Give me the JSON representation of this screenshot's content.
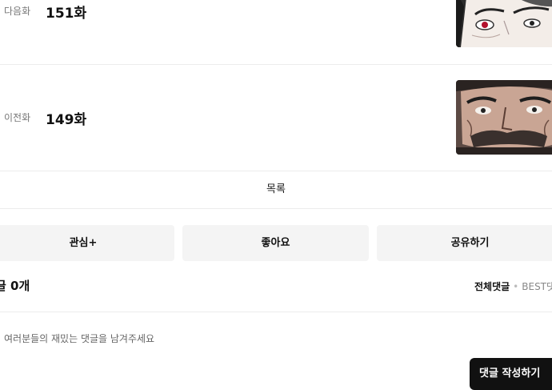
{
  "episodes": {
    "next": {
      "tag": "다음화",
      "title": "151화"
    },
    "prev": {
      "tag": "이전화",
      "title": "149화"
    }
  },
  "list_label": "목록",
  "actions": {
    "subscribe": "관심+",
    "like": "좋아요",
    "share": "공유하기"
  },
  "comments": {
    "count_label": "글 0개",
    "sort_all": "전체댓글",
    "sort_best": "BEST댓",
    "placeholder": "여러분들의 재밌는 댓글을 남겨주세요",
    "write_label": "댓글 작성하기"
  }
}
